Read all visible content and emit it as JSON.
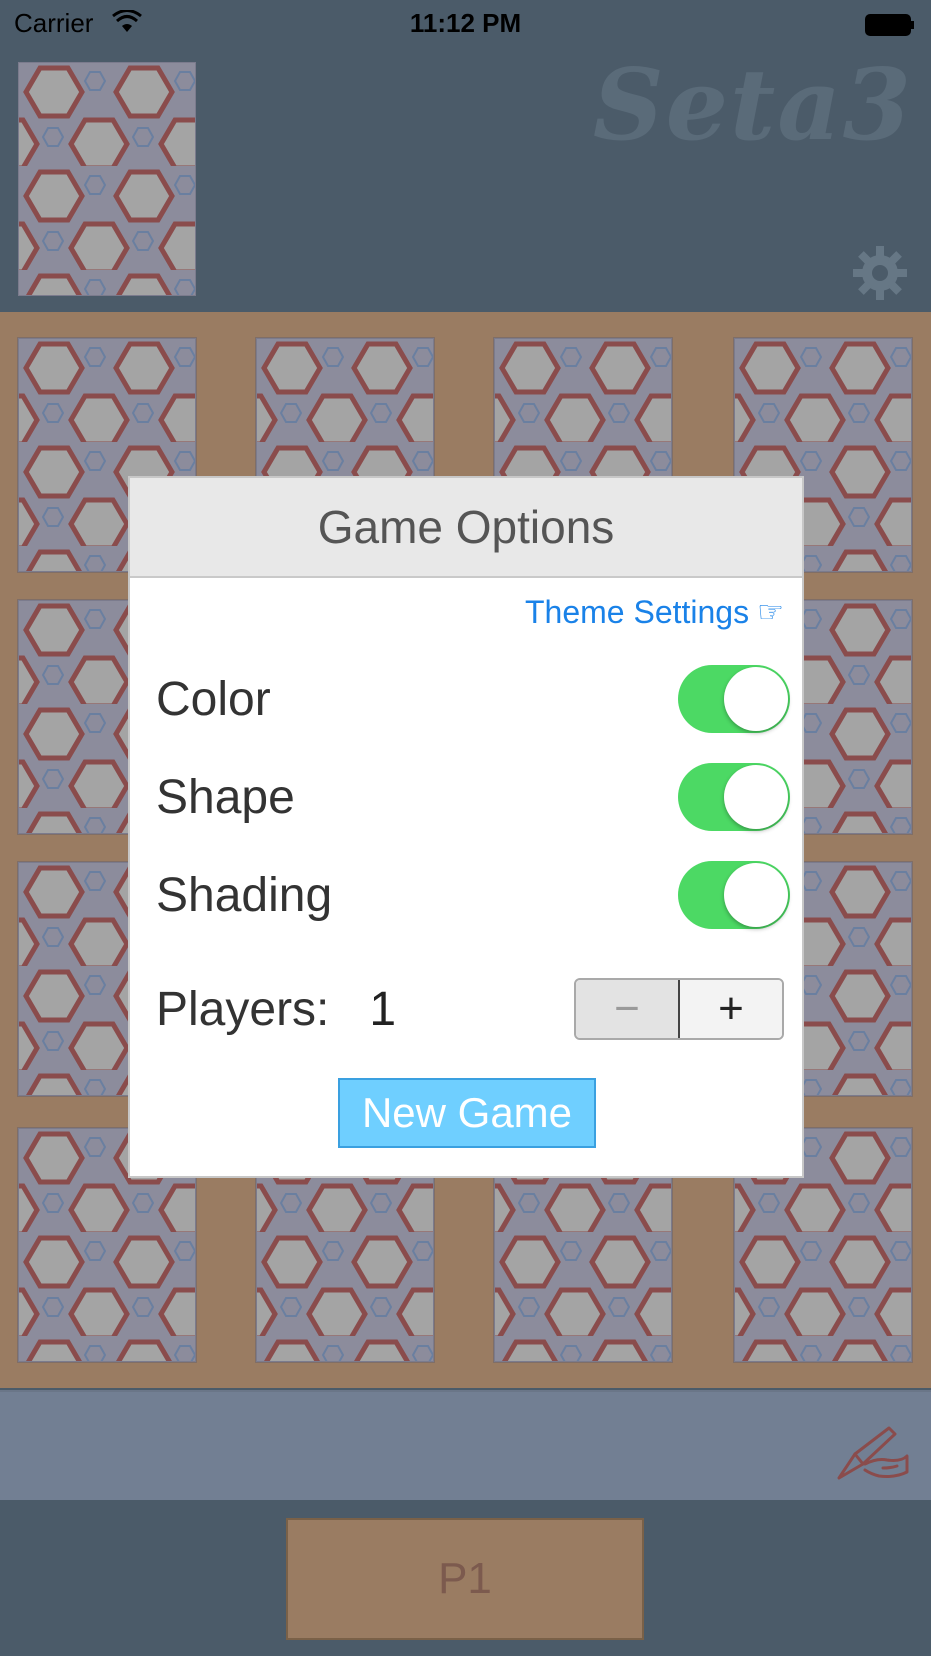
{
  "status_bar": {
    "carrier": "Carrier",
    "time": "11:12 PM"
  },
  "header": {
    "logo_text": "Seta3",
    "settings_icon": "gear-icon",
    "deck_icon": "card-back"
  },
  "board": {
    "card_count": 16,
    "card_back_pattern": "hexagons"
  },
  "message_bar": {
    "icon": "pencil-hand-icon"
  },
  "footer": {
    "players": [
      "P1"
    ]
  },
  "modal": {
    "title": "Game Options",
    "theme_link": "Theme Settings",
    "theme_link_icon": "☞",
    "options": [
      {
        "label": "Color",
        "enabled": true
      },
      {
        "label": "Shape",
        "enabled": true
      },
      {
        "label": "Shading",
        "enabled": true
      }
    ],
    "players_label": "Players:",
    "players_value": "1",
    "stepper_minus": "−",
    "stepper_plus": "+",
    "new_game_label": "New Game"
  },
  "colors": {
    "header_bg": "#4b5b69",
    "board_bg": "#9a7c62",
    "toggle_on": "#4cd964",
    "link": "#1a82e8",
    "new_game_bg": "#6fcfff"
  }
}
